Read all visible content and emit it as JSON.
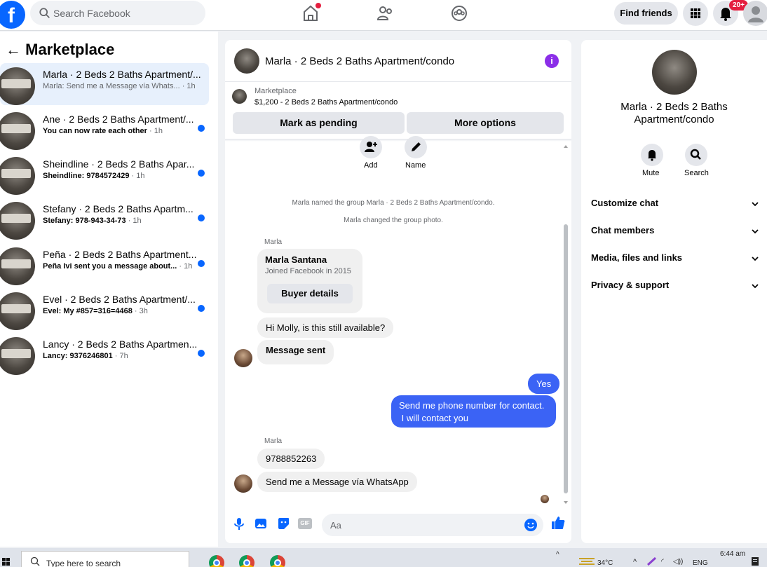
{
  "topbar": {
    "logo_letter": "f",
    "search_placeholder": "Search Facebook",
    "find_friends": "Find friends",
    "notif_count": "20+"
  },
  "sidebar": {
    "header": "Marketplace",
    "conversations": [
      {
        "title": "Marla · 2 Beds 2 Baths Apartment/...",
        "sub_lead": "Marla: Send me a Message vía Whats...",
        "sub_time": " · 1h",
        "unread": false
      },
      {
        "title": "Ane · 2 Beds 2 Baths Apartment/...",
        "sub_lead": "You can now rate each other",
        "sub_time": " · 1h",
        "unread": true
      },
      {
        "title": "Sheindline · 2 Beds 2 Baths Apar...",
        "sub_lead": "Sheindline: 9784572429",
        "sub_time": " · 1h",
        "unread": true
      },
      {
        "title": "Stefany · 2 Beds 2 Baths Apartm...",
        "sub_lead": "Stefany: 978-943-34-73",
        "sub_time": " · 1h",
        "unread": true
      },
      {
        "title": "Peña · 2 Beds 2 Baths Apartment...",
        "sub_lead": "Peña Ivi sent you a message about...",
        "sub_time": " · 1h",
        "unread": true
      },
      {
        "title": "Evel · 2 Beds 2 Baths Apartment/...",
        "sub_lead": "Evel: My #857=316=4468",
        "sub_time": " · 3h",
        "unread": true
      },
      {
        "title": "Lancy · 2 Beds 2 Baths Apartmen...",
        "sub_lead": "Lancy: 9376246801",
        "sub_time": " · 7h",
        "unread": true
      }
    ]
  },
  "chat": {
    "title": "Marla · 2 Beds 2 Baths Apartment/condo",
    "info_letter": "i",
    "marketplace_label": "Marketplace",
    "listing_line": "$1,200 - 2 Beds 2 Baths Apartment/condo",
    "mark_pending": "Mark as pending",
    "more_options": "More options",
    "add_label": "Add",
    "name_label": "Name",
    "system_1": "Marla named the group Marla · 2 Beds 2 Baths Apartment/condo.",
    "system_2": "Marla changed the group photo.",
    "sender_1": "Marla",
    "card_name": "Marla Santana",
    "card_joined": "Joined Facebook in 2015",
    "buyer_details": "Buyer details",
    "msg_available": "Hi Molly, is this still available?",
    "msg_sent": "Message sent",
    "msg_yes": "Yes",
    "msg_phone_1": "Send me phone number for contact.",
    "msg_phone_2": " I will contact you",
    "sender_2": "Marla",
    "msg_number": "9788852263",
    "msg_whatsapp": "Send me a Message vía WhatsApp",
    "composer_placeholder": "Aa",
    "gif_label": "GIF"
  },
  "info_panel": {
    "name": "Marla · 2 Beds 2 Baths Apartment/condo",
    "mute": "Mute",
    "search": "Search",
    "rows": [
      "Customize chat",
      "Chat members",
      "Media, files and links",
      "Privacy & support"
    ]
  },
  "taskbar": {
    "search_placeholder": "Type here to search",
    "temperature": "34°C",
    "lang": "ENG",
    "time": "6:44 am"
  },
  "colors": {
    "facebook_blue": "#0866ff",
    "my_bubble": "#3b63f5",
    "info_purple": "#8b2ee8",
    "notif_red": "#e41e3f"
  }
}
